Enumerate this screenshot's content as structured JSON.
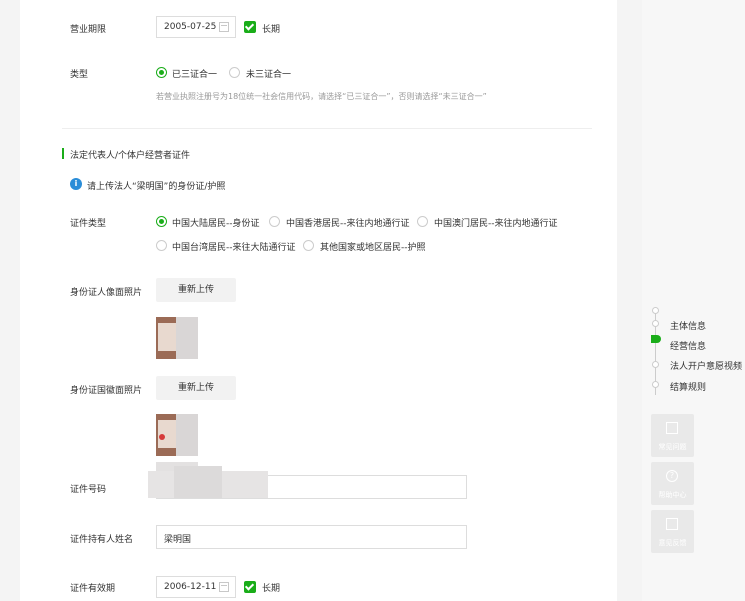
{
  "business_period": {
    "label": "营业期限",
    "date": "2005-07-25",
    "long_term": "长期"
  },
  "type": {
    "label": "类型",
    "options": [
      "已三证合一",
      "未三证合一"
    ],
    "hint": "若营业执照注册号为18位统一社会信用代码，请选择“已三证合一”，否则请选择“未三证合一”"
  },
  "section": {
    "title": "法定代表人/个体户经营者证件"
  },
  "notice": {
    "text": "请上传法人“梁明国”的身份证/护照"
  },
  "id_type": {
    "label": "证件类型",
    "options": [
      "中国大陆居民--身份证",
      "中国香港居民--来往内地通行证",
      "中国澳门居民--来往内地通行证",
      "中国台湾居民--来往大陆通行证",
      "其他国家或地区居民--护照"
    ]
  },
  "front_photo": {
    "label": "身份证人像面照片",
    "button": "重新上传"
  },
  "back_photo": {
    "label": "身份证国徽面照片",
    "button": "重新上传"
  },
  "id_number": {
    "label": "证件号码"
  },
  "holder_name": {
    "label": "证件持有人姓名",
    "value": "梁明国"
  },
  "id_validity": {
    "label": "证件有效期",
    "date": "2006-12-11",
    "long_term": "长期"
  },
  "steps": [
    "主体信息",
    "经营信息",
    "法人开户意愿视频",
    "结算规则"
  ],
  "tools": [
    "常见问题",
    "帮助中心",
    "意见反馈"
  ],
  "colors": {
    "accent": "#1aad19",
    "info": "#2a8dd8"
  }
}
